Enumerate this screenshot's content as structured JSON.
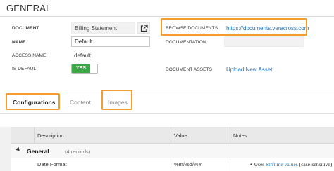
{
  "page": {
    "title": "GENERAL"
  },
  "left_fields": {
    "document_label": "DOCUMENT",
    "document_value": "Billing Statement",
    "name_label": "NAME",
    "name_value": "Default",
    "access_name_label": "ACCESS NAME",
    "access_name_value": "default",
    "is_default_label": "IS DEFAULT",
    "is_default_value": "YES"
  },
  "right_fields": {
    "browse_documents_label": "BROWSE DOCUMENTS",
    "browse_documents_link": "https://documents.veracross.com",
    "documentation_label": "DOCUMENTATION",
    "document_assets_label": "DOCUMENT ASSETS",
    "document_assets_link": "Upload New Asset"
  },
  "tabs": [
    {
      "label": "Configurations",
      "active": true
    },
    {
      "label": "Content",
      "active": false
    },
    {
      "label": "Images",
      "active": false
    }
  ],
  "grid": {
    "columns": [
      "Description",
      "Value",
      "Notes"
    ],
    "group": {
      "name": "General",
      "count": "(4 records)"
    },
    "rows": [
      {
        "description": "Date Format",
        "value": "%m/%d/%Y",
        "notes_prefix": "Uses",
        "notes_link": "Strftime values",
        "notes_suffix": "(case-sensitive)"
      }
    ]
  },
  "colors": {
    "highlight": "#f29d2e",
    "toggle_on": "#3aa845",
    "link": "#1f6fb5"
  }
}
